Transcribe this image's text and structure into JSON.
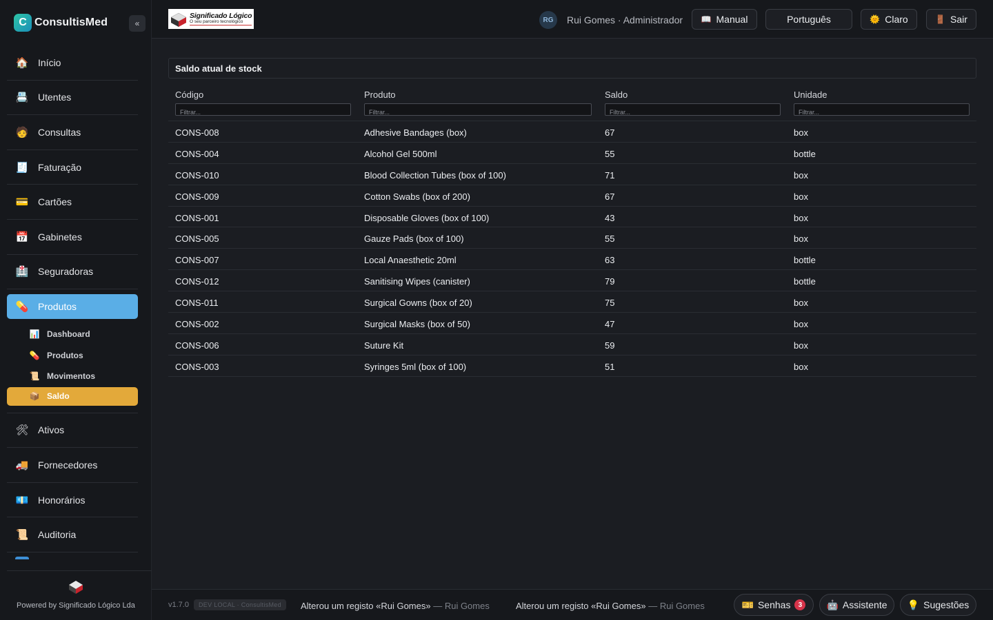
{
  "app": {
    "name": "ConsultisMed",
    "collapse_glyph": "«"
  },
  "sidebar": {
    "items": [
      {
        "label": "Início",
        "icon": "house-icon"
      },
      {
        "label": "Utentes",
        "icon": "patients-icon"
      },
      {
        "label": "Consultas",
        "icon": "doctor-icon"
      },
      {
        "label": "Faturação",
        "icon": "invoice-icon"
      },
      {
        "label": "Cartões",
        "icon": "card-icon"
      },
      {
        "label": "Gabinetes",
        "icon": "calendar-icon"
      },
      {
        "label": "Seguradoras",
        "icon": "insurance-icon"
      },
      {
        "label": "Produtos",
        "icon": "pill-icon"
      },
      {
        "label": "Ativos",
        "icon": "tools-icon"
      },
      {
        "label": "Fornecedores",
        "icon": "truck-icon"
      },
      {
        "label": "Honorários",
        "icon": "money-icon"
      },
      {
        "label": "Auditoria",
        "icon": "scroll-icon"
      }
    ],
    "active": "Produtos",
    "sub_items": [
      {
        "label": "Dashboard",
        "icon": "chart-icon"
      },
      {
        "label": "Produtos",
        "icon": "pill-icon"
      },
      {
        "label": "Movimentos",
        "icon": "scroll-icon"
      },
      {
        "label": "Saldo",
        "icon": "box-icon"
      }
    ],
    "active_sub": "Saldo",
    "powered_by": "Powered by Significado Lógico Lda"
  },
  "header": {
    "logo_title": "Significado Lógico",
    "logo_subtitle": "O seu parceiro tecnológico",
    "avatar_initials": "RG",
    "user": "Rui Gomes · Administrador",
    "buttons": {
      "manual": "Manual",
      "language": "Português",
      "theme": "Claro",
      "logout": "Sair"
    }
  },
  "main": {
    "panel_title": "Saldo atual de stock",
    "columns": [
      "Código",
      "Produto",
      "Saldo",
      "Unidade"
    ],
    "filter_placeholder": "Filtrar...",
    "rows": [
      {
        "code": "CONS-008",
        "product": "Adhesive Bandages (box)",
        "balance": "67",
        "unit": "box"
      },
      {
        "code": "CONS-004",
        "product": "Alcohol Gel 500ml",
        "balance": "55",
        "unit": "bottle"
      },
      {
        "code": "CONS-010",
        "product": "Blood Collection Tubes (box of 100)",
        "balance": "71",
        "unit": "box"
      },
      {
        "code": "CONS-009",
        "product": "Cotton Swabs (box of 200)",
        "balance": "67",
        "unit": "box"
      },
      {
        "code": "CONS-001",
        "product": "Disposable Gloves (box of 100)",
        "balance": "43",
        "unit": "box"
      },
      {
        "code": "CONS-005",
        "product": "Gauze Pads (box of 100)",
        "balance": "55",
        "unit": "box"
      },
      {
        "code": "CONS-007",
        "product": "Local Anaesthetic 20ml",
        "balance": "63",
        "unit": "bottle"
      },
      {
        "code": "CONS-012",
        "product": "Sanitising Wipes (canister)",
        "balance": "79",
        "unit": "bottle"
      },
      {
        "code": "CONS-011",
        "product": "Surgical Gowns (box of 20)",
        "balance": "75",
        "unit": "box"
      },
      {
        "code": "CONS-002",
        "product": "Surgical Masks (box of 50)",
        "balance": "47",
        "unit": "box"
      },
      {
        "code": "CONS-006",
        "product": "Suture Kit",
        "balance": "59",
        "unit": "box"
      },
      {
        "code": "CONS-003",
        "product": "Syringes 5ml (box of 100)",
        "balance": "51",
        "unit": "box"
      }
    ]
  },
  "footer": {
    "version": "v1.7.0",
    "env": "DEV LOCAL · ConsultisMed",
    "logs": [
      {
        "text": "Alterou um registo «Rui Gomes»",
        "who": "— Rui Gomes"
      },
      {
        "text": "Alterou um registo «Rui Gomes»",
        "who": "— Rui Gomes"
      }
    ],
    "buttons": {
      "tickets": "Senhas",
      "tickets_count": "3",
      "assistant": "Assistente",
      "suggestions": "Sugestões"
    }
  },
  "colors": {
    "accent_blue": "#5aaee6",
    "accent_orange": "#e3a93a",
    "badge_red": "#d6344a",
    "brand_teal": "#2ec4a6"
  }
}
